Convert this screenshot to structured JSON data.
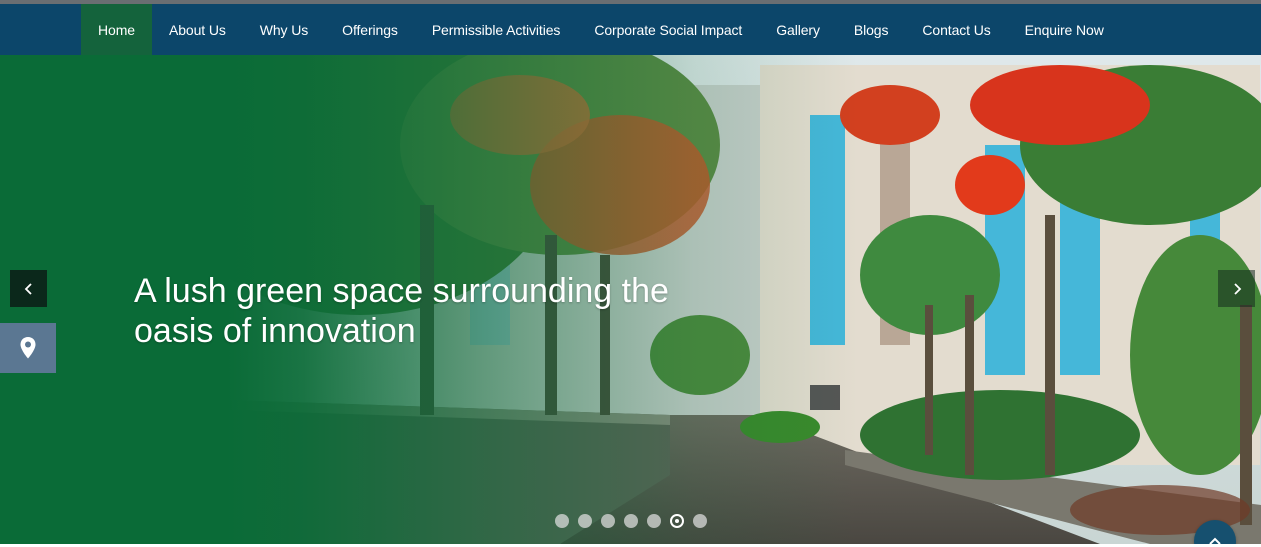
{
  "nav": {
    "items": [
      {
        "label": "Home",
        "active": true
      },
      {
        "label": "About Us"
      },
      {
        "label": "Why Us"
      },
      {
        "label": "Offerings"
      },
      {
        "label": "Permissible Activities"
      },
      {
        "label": "Corporate Social Impact"
      },
      {
        "label": "Gallery"
      },
      {
        "label": "Blogs"
      },
      {
        "label": "Contact Us"
      },
      {
        "label": "Enquire Now"
      }
    ]
  },
  "hero": {
    "headline_line1": "A lush green space surrounding the",
    "headline_line2": "oasis of innovation",
    "slide_count": 7,
    "active_slide": 6
  },
  "icons": {
    "prev": "chevron-left-icon",
    "next": "chevron-right-icon",
    "location": "map-pin-icon",
    "scroll_top": "chevron-up-icon"
  },
  "colors": {
    "nav_bg": "#0c466a",
    "nav_active": "#14633c",
    "hero_green": "#0a6b37",
    "location_tab": "#5b7792",
    "scroll_top": "#16506f"
  }
}
